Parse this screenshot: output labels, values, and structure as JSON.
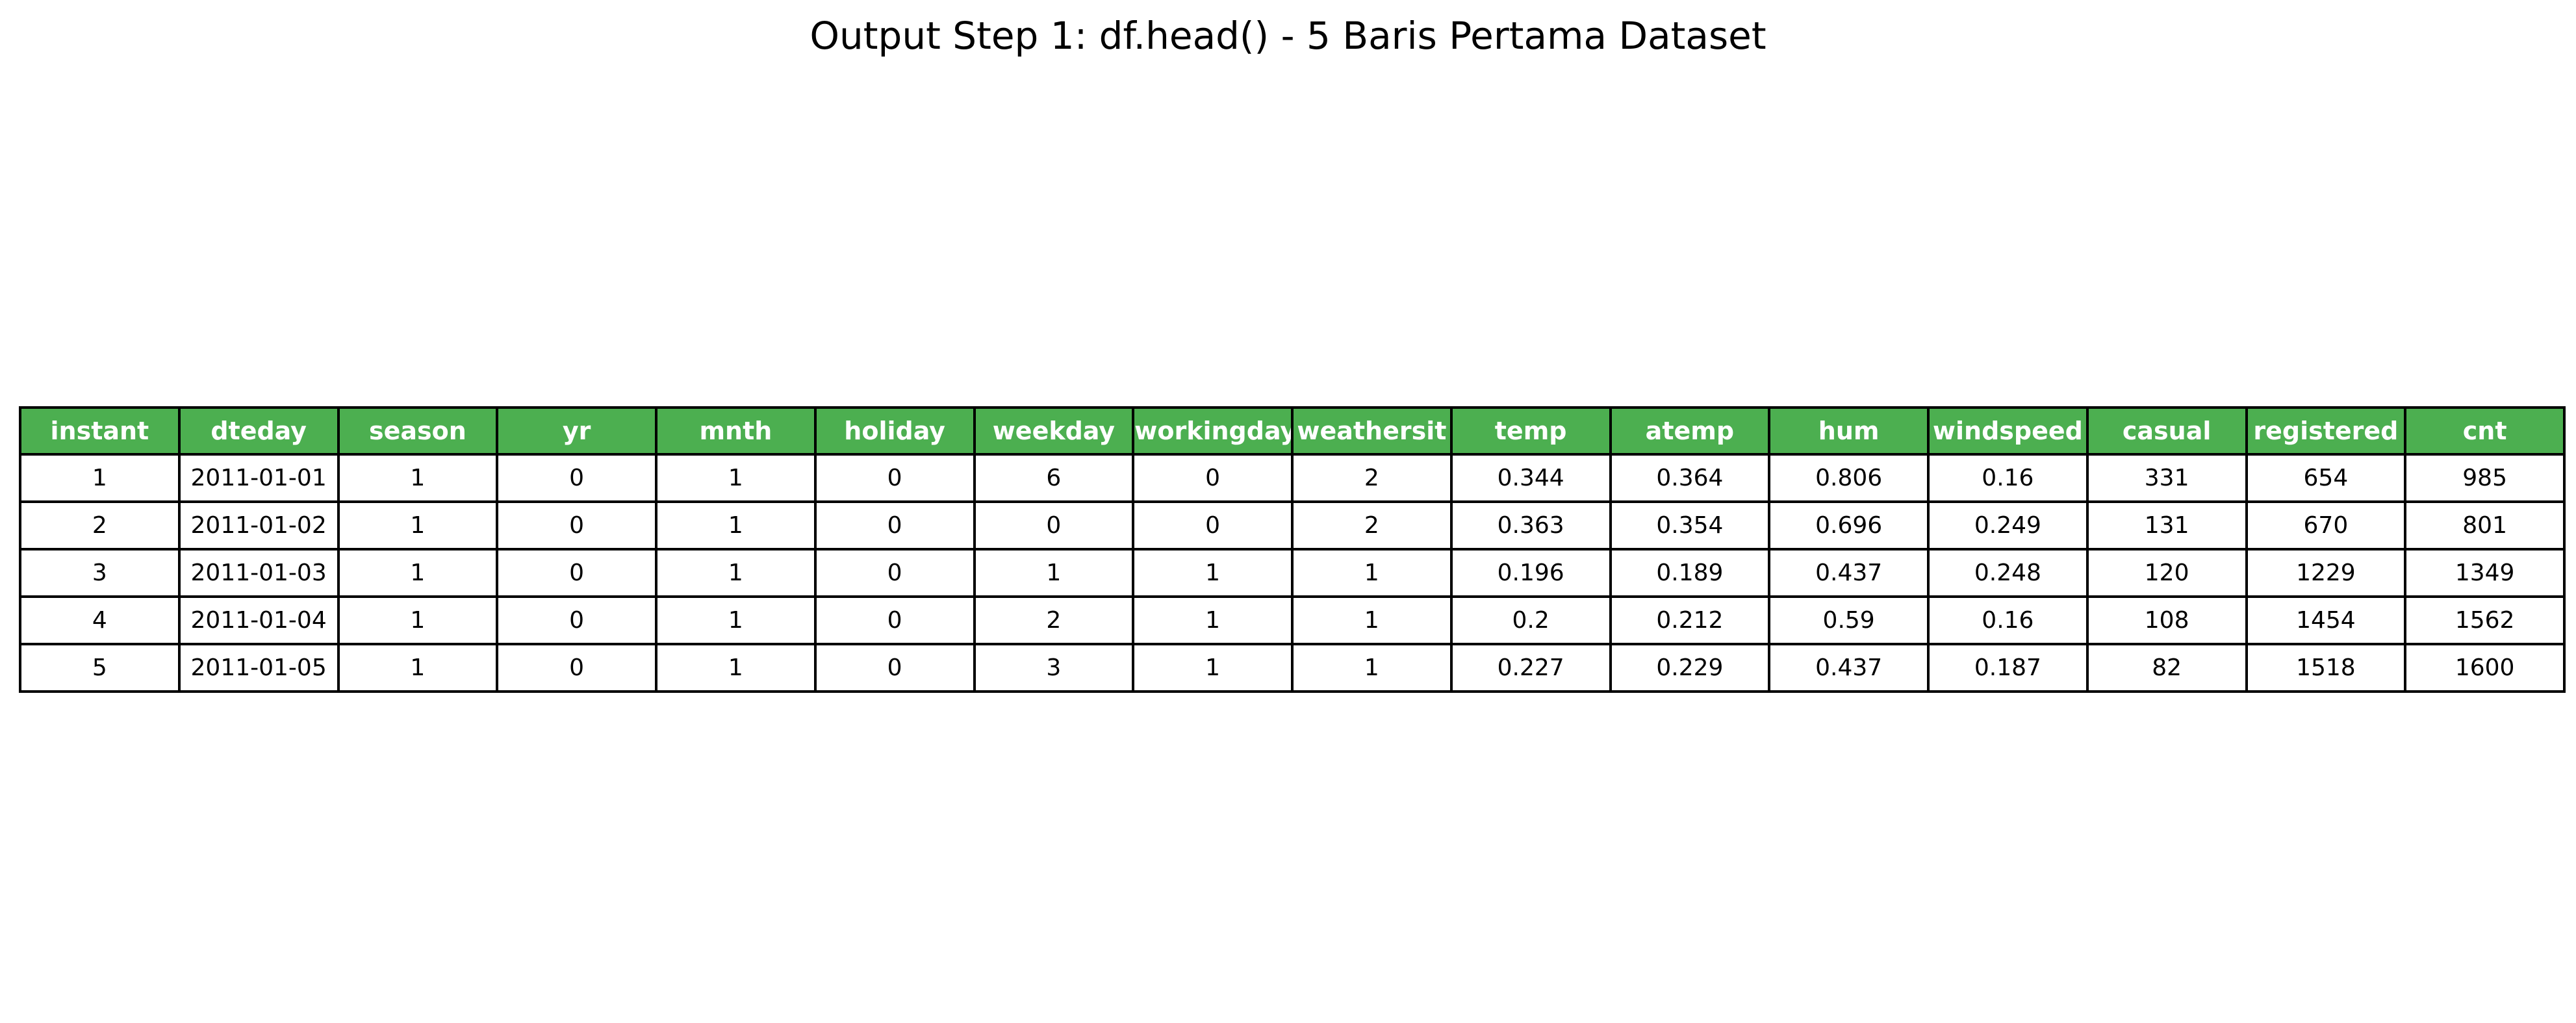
{
  "chart_data": {
    "type": "table",
    "title": "Output Step 1: df.head() - 5 Baris Pertama Dataset",
    "header_color": "#4caf50",
    "header_text_color": "#ffffff",
    "columns": [
      "instant",
      "dteday",
      "season",
      "yr",
      "mnth",
      "holiday",
      "weekday",
      "workingday",
      "weathersit",
      "temp",
      "atemp",
      "hum",
      "windspeed",
      "casual",
      "registered",
      "cnt"
    ],
    "rows": [
      [
        "1",
        "2011-01-01",
        "1",
        "0",
        "1",
        "0",
        "6",
        "0",
        "2",
        "0.344",
        "0.364",
        "0.806",
        "0.16",
        "331",
        "654",
        "985"
      ],
      [
        "2",
        "2011-01-02",
        "1",
        "0",
        "1",
        "0",
        "0",
        "0",
        "2",
        "0.363",
        "0.354",
        "0.696",
        "0.249",
        "131",
        "670",
        "801"
      ],
      [
        "3",
        "2011-01-03",
        "1",
        "0",
        "1",
        "0",
        "1",
        "1",
        "1",
        "0.196",
        "0.189",
        "0.437",
        "0.248",
        "120",
        "1229",
        "1349"
      ],
      [
        "4",
        "2011-01-04",
        "1",
        "0",
        "1",
        "0",
        "2",
        "1",
        "1",
        "0.2",
        "0.212",
        "0.59",
        "0.16",
        "108",
        "1454",
        "1562"
      ],
      [
        "5",
        "2011-01-05",
        "1",
        "0",
        "1",
        "0",
        "3",
        "1",
        "1",
        "0.227",
        "0.229",
        "0.437",
        "0.187",
        "82",
        "1518",
        "1600"
      ]
    ]
  }
}
